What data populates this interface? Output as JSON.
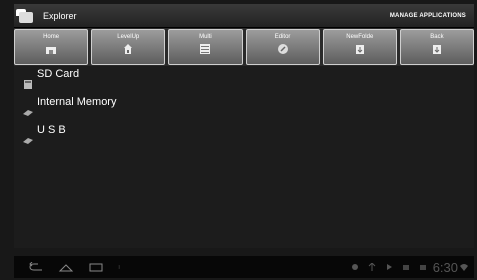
{
  "app": {
    "title": "Explorer",
    "manage_label": "MANAGE APPLICATIONS"
  },
  "toolbar": {
    "buttons": [
      {
        "label": "Home",
        "icon": "home-icon"
      },
      {
        "label": "LevelUp",
        "icon": "level-up-icon"
      },
      {
        "label": "Multi",
        "icon": "multi-select-icon"
      },
      {
        "label": "Editor",
        "icon": "editor-icon"
      },
      {
        "label": "NewFolde",
        "icon": "new-folder-icon"
      },
      {
        "label": "Back",
        "icon": "back-icon"
      }
    ]
  },
  "storage": {
    "items": [
      {
        "label": "SD Card",
        "icon": "sd-card-icon"
      },
      {
        "label": "Internal Memory",
        "icon": "drive-icon"
      },
      {
        "label": "U S B",
        "icon": "drive-icon"
      }
    ]
  },
  "statusbar": {
    "time": "6:30"
  }
}
